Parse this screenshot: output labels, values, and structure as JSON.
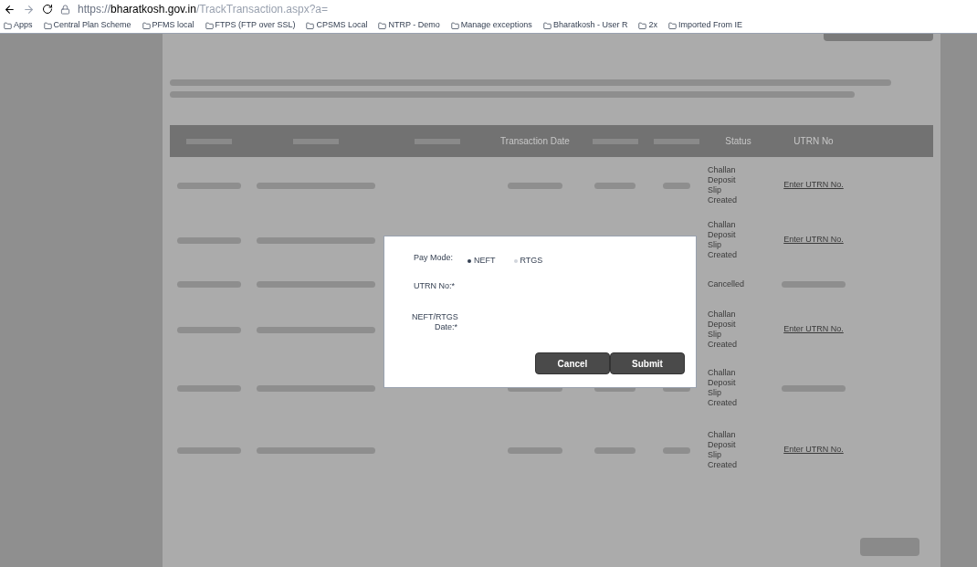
{
  "browser": {
    "url_domain": "https://bharatkosh.gov.in",
    "url_path": "/TrackTransaction.aspx?a=",
    "bookmarks": [
      {
        "label": "Apps"
      },
      {
        "label": "Central Plan Scheme"
      },
      {
        "label": "PFMS local"
      },
      {
        "label": "FTPS (FTP over SSL)"
      },
      {
        "label": "CPSMS Local"
      },
      {
        "label": "NTRP - Demo"
      },
      {
        "label": "Manage exceptions"
      },
      {
        "label": "Bharatkosh - User R"
      },
      {
        "label": "2x"
      },
      {
        "label": "Imported From IE"
      }
    ]
  },
  "table": {
    "columns": [
      {},
      {},
      {},
      {
        "label": "Transaction Date"
      },
      {},
      {},
      {
        "label": "Status"
      },
      {
        "label": "UTRN No"
      }
    ],
    "rows": [
      {
        "status": "Challan Deposit Slip Created",
        "utrn": "Enter UTRN No."
      },
      {
        "status": "Challan Deposit Slip Created",
        "utrn": "Enter UTRN No."
      },
      {
        "status": "Cancelled",
        "utrn": null
      },
      {
        "status": "Challan Deposit Slip Created",
        "utrn": "Enter UTRN No."
      },
      {
        "status": "Challan Deposit Slip Created",
        "utrn": null
      },
      {
        "status": "Challan Deposit Slip Created",
        "utrn": "Enter UTRN No."
      }
    ]
  },
  "dialog": {
    "pay_mode_label": "Pay Mode:",
    "options": [
      {
        "label": "NEFT",
        "selected": true
      },
      {
        "label": "RTGS",
        "selected": false
      }
    ],
    "utrn_label": "UTRN No:*",
    "date_label": "NEFT/RTGS Date:*",
    "buttons": [
      "Cancel",
      "Submit"
    ]
  }
}
